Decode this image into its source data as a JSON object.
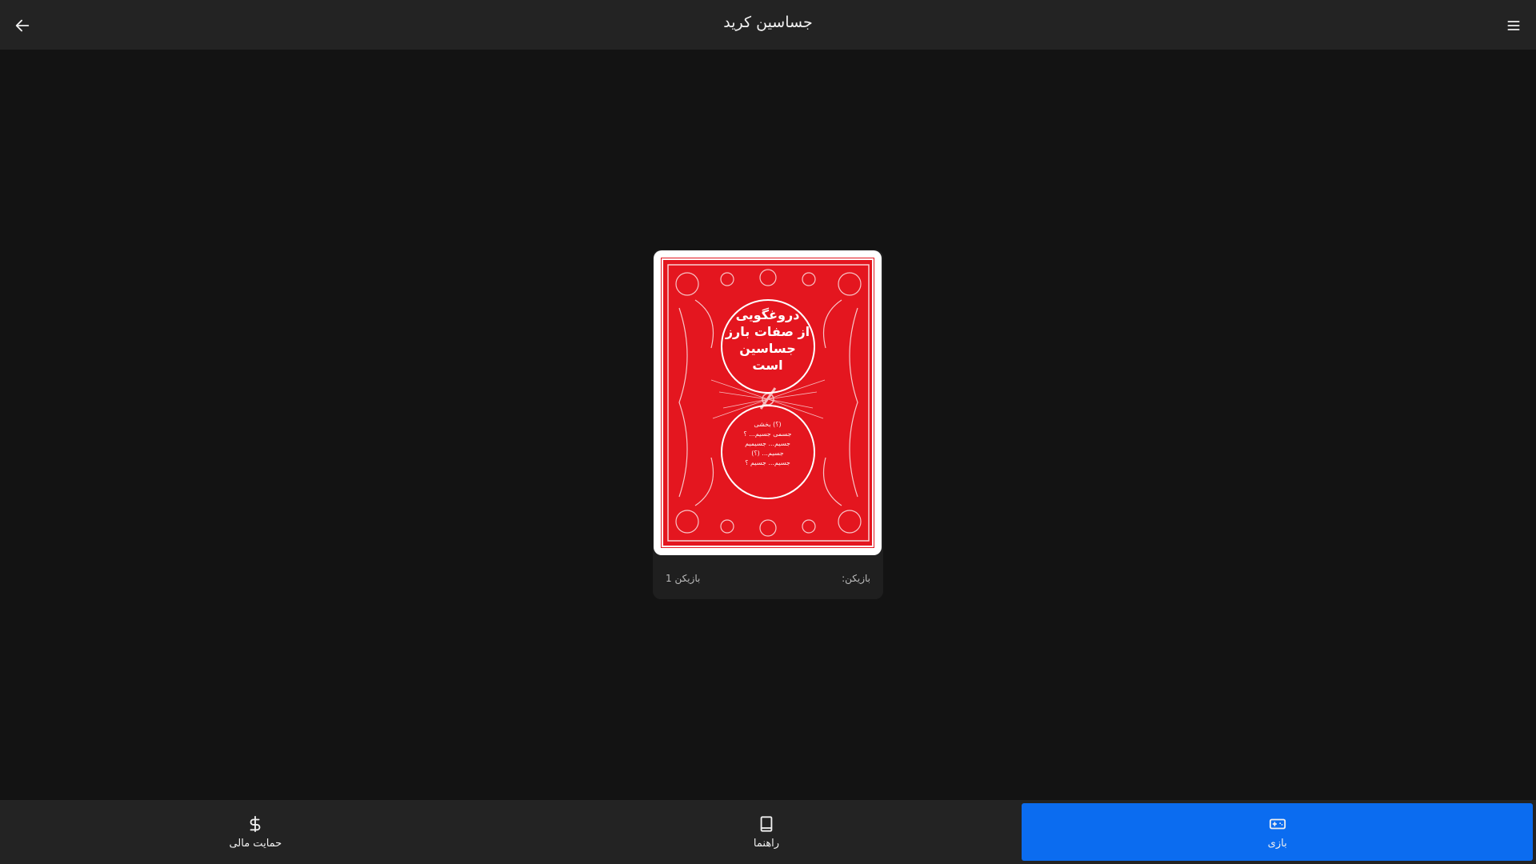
{
  "header": {
    "title": "جساسین کرید",
    "back_icon": "arrow-left-icon",
    "menu_icon": "hamburger-menu-icon"
  },
  "card": {
    "main_text_lines": [
      "دروغگویی",
      "از صفات بارز",
      "جساسین",
      "است"
    ],
    "sub_text_lines": [
      "(؟) بخشی",
      "جسمی جسیم... ؟",
      "جسیم... جسیمیم",
      "جسیم... (؟)",
      "جسیم... جسیم ؟"
    ],
    "footer_label": "بازیکن:",
    "footer_value": "بازیکن 1"
  },
  "nav": {
    "items": [
      {
        "label": "بازی",
        "icon": "gamepad-icon",
        "active": true
      },
      {
        "label": "راهنما",
        "icon": "book-icon",
        "active": false
      },
      {
        "label": "حمایت مالی",
        "icon": "dollar-icon",
        "active": false
      }
    ]
  },
  "colors": {
    "background": "#131313",
    "bar": "#232323",
    "accent": "#0b6cf0",
    "card_red": "#e4161f"
  }
}
